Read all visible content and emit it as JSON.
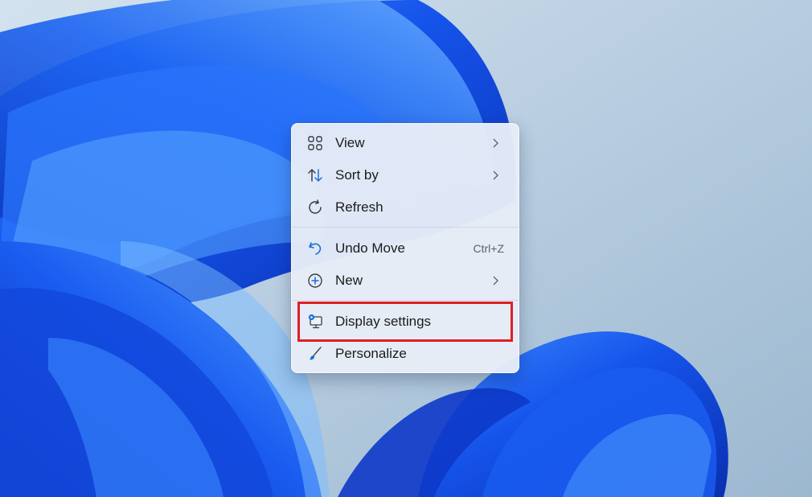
{
  "desktop": {
    "accent": "#1a55e8"
  },
  "context_menu": {
    "items": [
      {
        "label": "View",
        "icon": "grid-view-icon",
        "submenu": true
      },
      {
        "label": "Sort by",
        "icon": "sort-arrows-icon",
        "submenu": true
      },
      {
        "label": "Refresh",
        "icon": "refresh-icon",
        "submenu": false
      },
      {
        "label": "Undo Move",
        "icon": "undo-icon",
        "shortcut": "Ctrl+Z",
        "submenu": false
      },
      {
        "label": "New",
        "icon": "plus-circle-icon",
        "submenu": true
      },
      {
        "label": "Display settings",
        "icon": "display-settings-icon",
        "submenu": false,
        "highlighted": true
      },
      {
        "label": "Personalize",
        "icon": "paintbrush-icon",
        "submenu": false
      }
    ],
    "highlight_color": "#e01e26"
  }
}
